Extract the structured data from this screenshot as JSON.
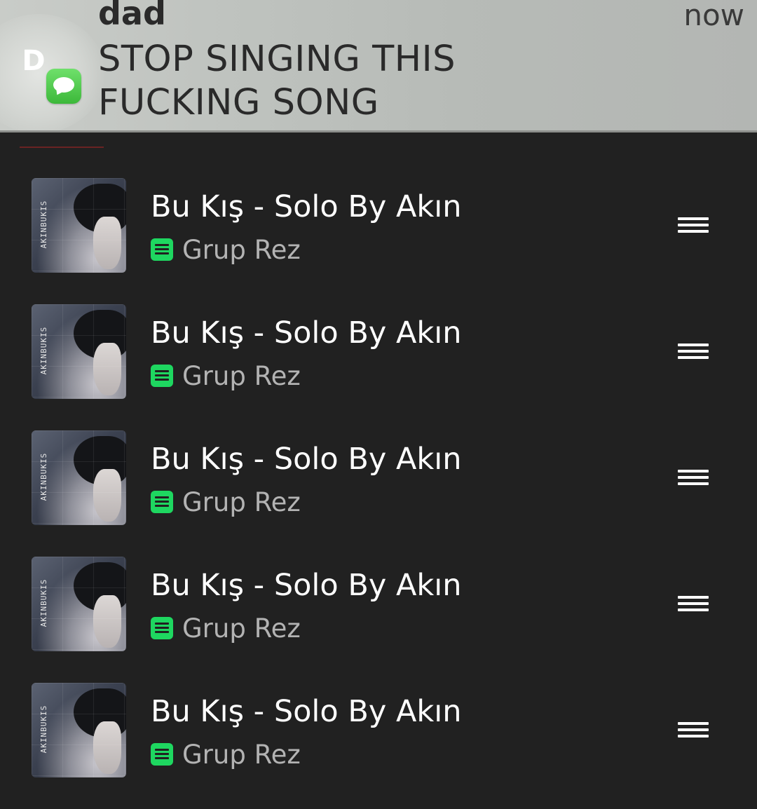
{
  "notification": {
    "avatar_letter": "D",
    "app_icon": "messages-icon",
    "sender": "dad",
    "time": "now",
    "message_line1": "STOP SINGING THIS",
    "message_line2": "FUCKING SONG"
  },
  "colors": {
    "background": "#212121",
    "accent_green": "#1ed760",
    "title_text": "#ffffff",
    "subtitle_text": "#b3b3b3"
  },
  "tracks": [
    {
      "title": "Bu Kış - Solo By Akın",
      "artist": "Grup Rez",
      "cover_text": "AKINBUKIS",
      "downloaded_icon": "downloaded-icon",
      "handle_icon": "drag-handle-icon"
    },
    {
      "title": "Bu Kış - Solo By Akın",
      "artist": "Grup Rez",
      "cover_text": "AKINBUKIS",
      "downloaded_icon": "downloaded-icon",
      "handle_icon": "drag-handle-icon"
    },
    {
      "title": "Bu Kış - Solo By Akın",
      "artist": "Grup Rez",
      "cover_text": "AKINBUKIS",
      "downloaded_icon": "downloaded-icon",
      "handle_icon": "drag-handle-icon"
    },
    {
      "title": "Bu Kış - Solo By Akın",
      "artist": "Grup Rez",
      "cover_text": "AKINBUKIS",
      "downloaded_icon": "downloaded-icon",
      "handle_icon": "drag-handle-icon"
    },
    {
      "title": "Bu Kış - Solo By Akın",
      "artist": "Grup Rez",
      "cover_text": "AKINBUKIS",
      "downloaded_icon": "downloaded-icon",
      "handle_icon": "drag-handle-icon"
    }
  ]
}
